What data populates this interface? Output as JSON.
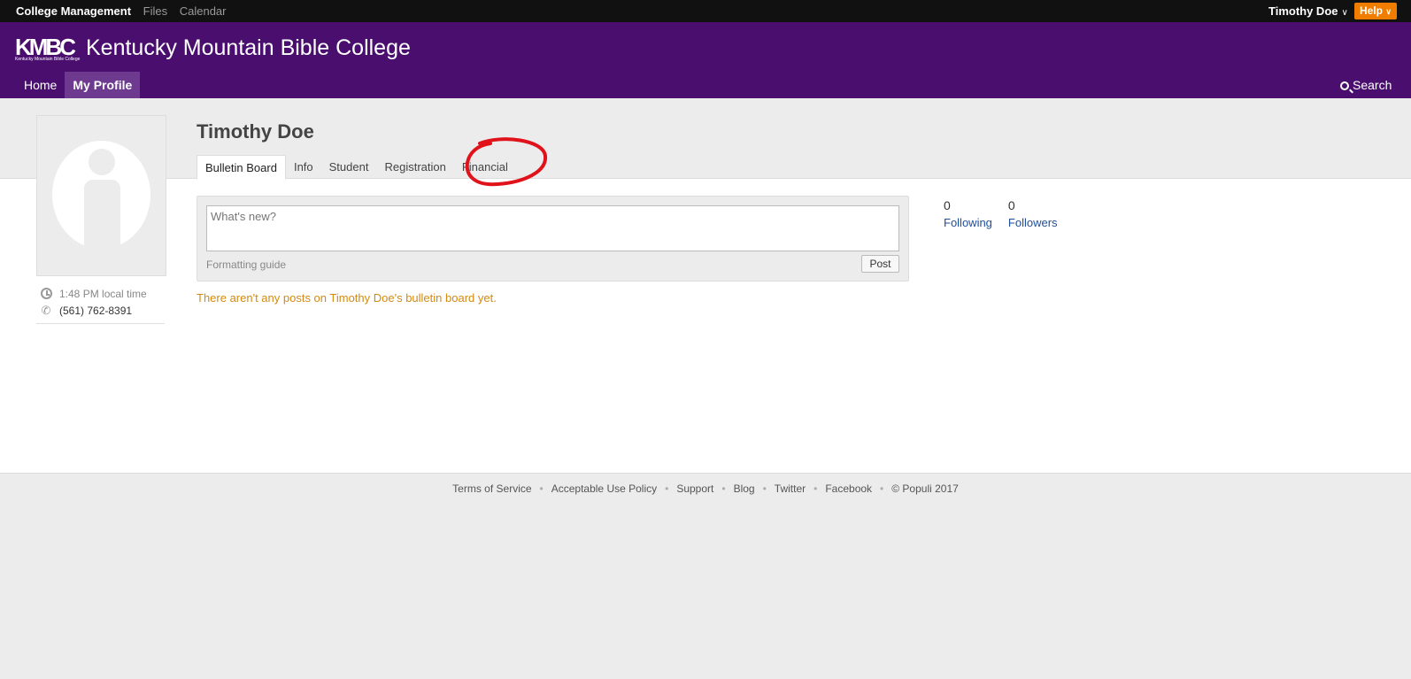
{
  "topbar": {
    "items": [
      "College Management",
      "Files",
      "Calendar"
    ],
    "user_name": "Timothy Doe",
    "help_label": "Help"
  },
  "header": {
    "logo_text": "KMBC",
    "logo_subtext": "Kentucky Mountain Bible College",
    "college_name": "Kentucky Mountain Bible College",
    "nav": [
      "Home",
      "My Profile"
    ],
    "search_label": "Search"
  },
  "profile": {
    "name": "Timothy Doe",
    "tabs": [
      "Bulletin Board",
      "Info",
      "Student",
      "Registration",
      "Financial"
    ],
    "local_time": "1:48 PM local time",
    "phone": "(561) 762-8391"
  },
  "post": {
    "placeholder": "What's new?",
    "formatting_guide": "Formatting guide",
    "post_label": "Post",
    "empty_message": "There aren't any posts on Timothy Doe's bulletin board yet."
  },
  "stats": {
    "following_count": "0",
    "following_label": "Following",
    "followers_count": "0",
    "followers_label": "Followers"
  },
  "footer": {
    "links": [
      "Terms of Service",
      "Acceptable Use Policy",
      "Support",
      "Blog",
      "Twitter",
      "Facebook",
      "© Populi 2017"
    ]
  },
  "colors": {
    "header_purple": "#4a0f6e",
    "help_orange": "#f07d00",
    "annotation_red": "#e0121a"
  }
}
